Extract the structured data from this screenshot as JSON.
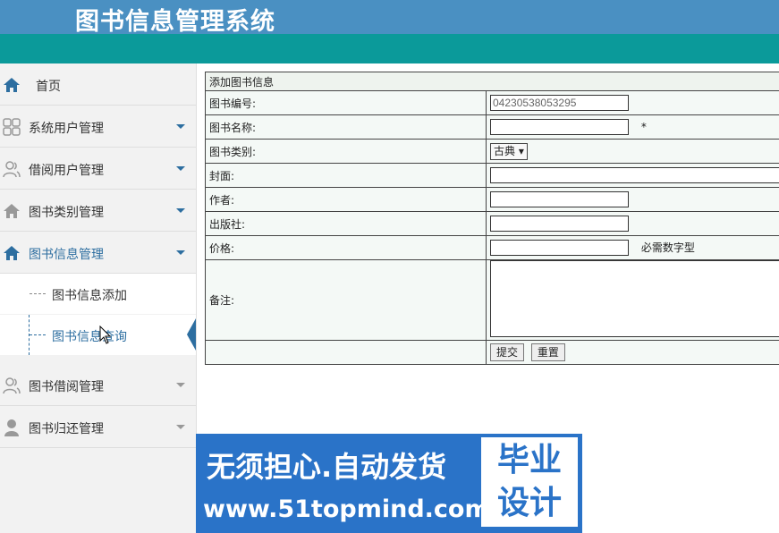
{
  "header": {
    "title": "图书信息管理系统"
  },
  "sidebar": {
    "items": [
      {
        "label": "首页"
      },
      {
        "label": "系统用户管理"
      },
      {
        "label": "借阅用户管理"
      },
      {
        "label": "图书类别管理"
      },
      {
        "label": "图书信息管理"
      },
      {
        "label": "图书借阅管理"
      },
      {
        "label": "图书归还管理"
      }
    ],
    "subitems": [
      {
        "label": "图书信息添加"
      },
      {
        "label": "图书信息查询"
      }
    ]
  },
  "form": {
    "title": "添加图书信息",
    "rows": [
      {
        "label": "图书编号:",
        "value": "04230538053295"
      },
      {
        "label": "图书名称:",
        "value": "",
        "note": "*"
      },
      {
        "label": "图书类别:",
        "value": "古典"
      },
      {
        "label": "封面:",
        "value": ""
      },
      {
        "label": "作者:",
        "value": ""
      },
      {
        "label": "出版社:",
        "value": ""
      },
      {
        "label": "价格:",
        "value": "",
        "note": "必需数字型"
      },
      {
        "label": "备注:",
        "value": ""
      }
    ],
    "submit": "提交",
    "reset": "重置"
  },
  "ad": {
    "line1": "无须担心.自动发货",
    "line2": "www.51topmind.com",
    "box1": "毕业",
    "box2": "设计"
  },
  "colors": {
    "header": "#4a90c2",
    "teal": "#0b9a9a",
    "accent": "#2d6ea0"
  }
}
